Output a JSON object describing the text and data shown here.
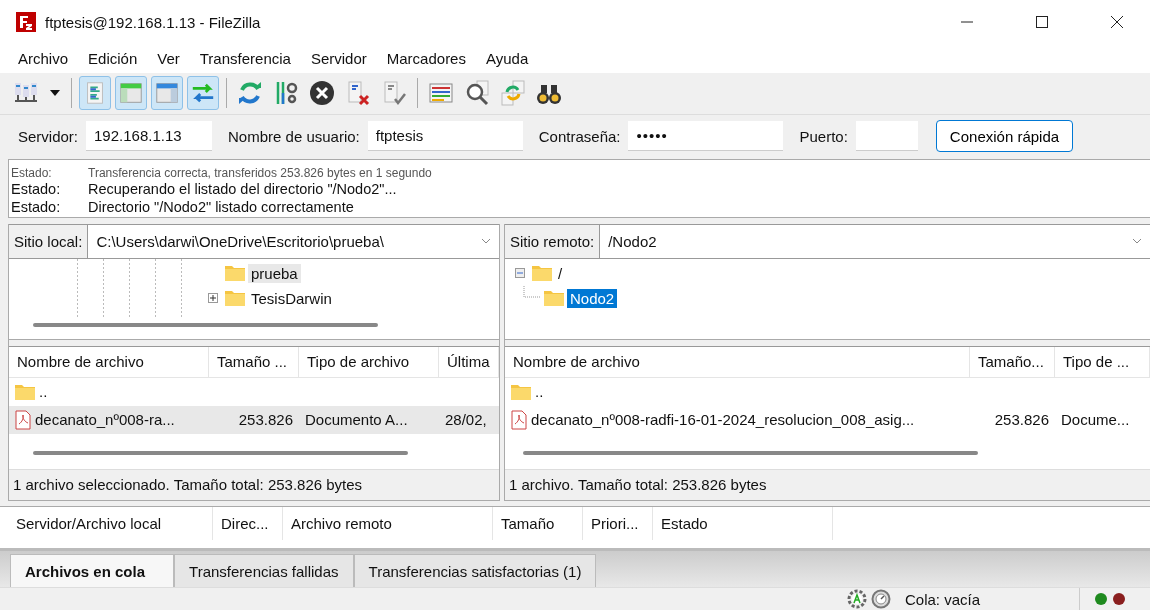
{
  "window": {
    "title": "ftptesis@192.168.1.13 - FileZilla"
  },
  "menu": [
    "Archivo",
    "Edición",
    "Ver",
    "Transferencia",
    "Servidor",
    "Marcadores",
    "Ayuda"
  ],
  "toolbar": {
    "toggles": [
      {
        "selected": true
      },
      {
        "selected": true
      },
      {
        "selected": true
      },
      {
        "selected": true
      }
    ]
  },
  "quickconnect": {
    "fields": [
      {
        "label": "Servidor:",
        "value": "192.168.1.13",
        "kind": "text"
      },
      {
        "label": "Nombre de usuario:",
        "value": "ftptesis",
        "kind": "text"
      },
      {
        "label": "Contraseña:",
        "value": "•••••",
        "kind": "password"
      },
      {
        "label": "Puerto:",
        "kind": "port"
      }
    ],
    "button": "Conexión rápida"
  },
  "log": [
    {
      "label": "Estado:",
      "message": "Transferencia correcta, transferidos 253.826 bytes en 1 segundo"
    },
    {
      "label": "Estado:",
      "message": "Recuperando el listado del directorio \"/Nodo2\"..."
    },
    {
      "label": "Estado:",
      "message": "Directorio \"/Nodo2\" listado correctamente"
    }
  ],
  "local": {
    "label": "Sitio local:",
    "path": "C:\\Users\\darwi\\OneDrive\\Escritorio\\prueba\\",
    "tree": [
      {
        "name": "prueba",
        "selected": true,
        "expandable": false
      },
      {
        "name": "TesisDarwin",
        "selected": false,
        "expandable": true
      }
    ],
    "columns": [
      "Nombre de archivo",
      "Tamaño ...",
      "Tipo de archivo",
      "Última"
    ],
    "rows": [
      {
        "kind": "parent",
        "selected": false,
        "cells": [
          ".."
        ]
      },
      {
        "kind": "pdf",
        "selected": true,
        "cells": [
          "decanato_nº008-ra...",
          "253.826",
          "Documento A...",
          "28/02,"
        ]
      }
    ],
    "status": "1 archivo seleccionado. Tamaño total: 253.826 bytes"
  },
  "remote": {
    "label": "Sitio remoto:",
    "path": "/Nodo2",
    "tree": [
      {
        "name": "/",
        "expanded": true,
        "selected": false,
        "children": [
          {
            "name": "Nodo2",
            "selected": true
          }
        ]
      }
    ],
    "columns": [
      "Nombre de archivo",
      "Tamaño...",
      "Tipo de ..."
    ],
    "rows": [
      {
        "kind": "parent",
        "selected": false,
        "cells": [
          ".."
        ]
      },
      {
        "kind": "pdf",
        "selected": false,
        "cells": [
          "decanato_nº008-radfi-16-01-2024_resolucion_008_asig...",
          "253.826",
          "Docume..."
        ]
      }
    ],
    "status": "1 archivo. Tamaño total: 253.826 bytes"
  },
  "queue": {
    "columns": [
      "Servidor/Archivo local",
      "Direc...",
      "Archivo remoto",
      "Tamaño",
      "Priori...",
      "Estado"
    ],
    "tabs": [
      {
        "label": "Archivos en cola",
        "selected": true
      },
      {
        "label": "Transferencias fallidas",
        "selected": false
      },
      {
        "label": "Transferencias satisfactorias (1)",
        "selected": false
      }
    ]
  },
  "status_bar": {
    "queue": "Cola: vacía",
    "leds": [
      {
        "color": "#1f8a1f"
      },
      {
        "color": "#8a1f1f"
      }
    ]
  }
}
